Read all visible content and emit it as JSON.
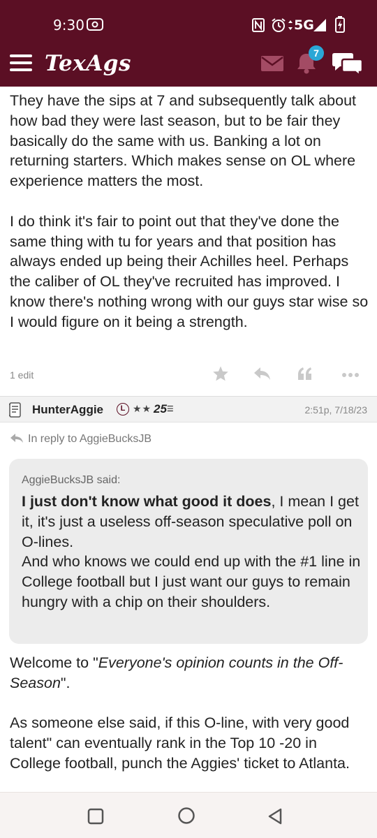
{
  "status_bar": {
    "time": "9:30",
    "network": "5G",
    "icons": [
      "screen-record-icon",
      "nfc-icon",
      "alarm-icon",
      "data-arrows-icon",
      "signal-icon",
      "battery-charging-icon"
    ]
  },
  "app_bar": {
    "logo": "TexAgs",
    "notification_count": "7",
    "colors": {
      "brand": "#5b0f24",
      "badge": "#2aa7d6"
    },
    "icons": [
      "menu-icon",
      "mail-icon",
      "bell-icon",
      "chat-icon"
    ]
  },
  "post": {
    "paragraph_1": "They have the sips at 7 and subsequently talk about how bad they were last season, but to be fair they basically do the same with us. Banking a lot on returning starters. Which makes sense on OL where experience matters the most.",
    "paragraph_2": "I do think it's fair to point out that they've done the same thing with tu for years and that position has always ended up being their Achilles heel. Perhaps the caliber of OL they've recruited has improved. I know there's nothing wrong with our guys star wise so I would figure on it being a strength.",
    "edit_count": "1 edit",
    "action_icons": [
      "star-icon",
      "reply-icon",
      "quote-icon",
      "more-icon"
    ]
  },
  "reply": {
    "username": "HunterAggie",
    "badge": "L",
    "stars": "★★",
    "rank": "25",
    "timestamp": "2:51p, 7/18/23",
    "in_reply_to": "In reply to AggieBucksJB",
    "quote": {
      "author": "AggieBucksJB said:",
      "bold_text": "I just don't know what good it does",
      "text_1": ", I mean I get it, it's just a useless off-season speculative poll on O-lines.",
      "text_2": "And who knows we could end up with the #1 line in College football but I just want our guys to remain hungry with a chip on their shoulders."
    },
    "body_prefix": "Welcome to \"",
    "body_italic": "Everyone's opinion counts in the Off-Season",
    "body_suffix": "\".",
    "body_paragraph_2": "As someone else said, if this O-line, with very good talent\" can eventually rank in the Top 10 -20 in College football, punch the Aggies' ticket to Atlanta."
  },
  "nav_bar": {
    "icons": [
      "recents-icon",
      "home-icon",
      "back-icon"
    ]
  }
}
